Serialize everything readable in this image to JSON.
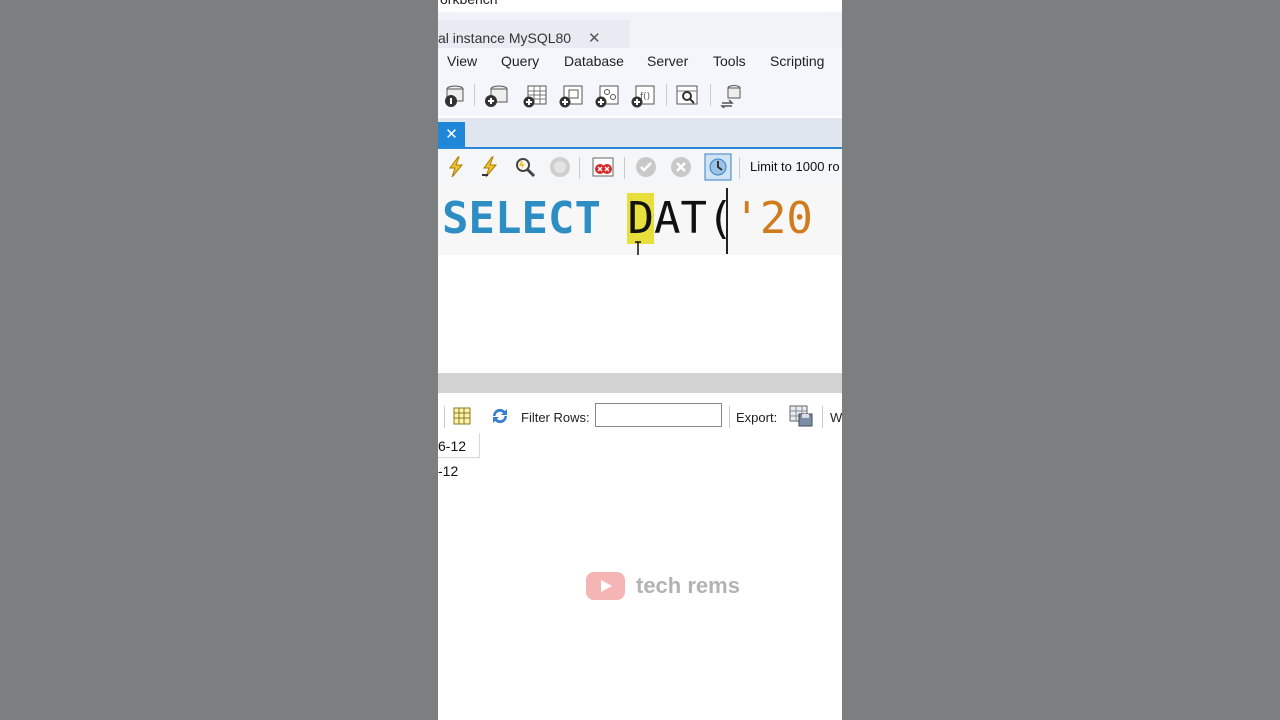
{
  "window": {
    "title_fragment": "orkbench"
  },
  "connection_tab": {
    "label": "al instance MySQL80",
    "close_label": "✕"
  },
  "menu": [
    "View",
    "Query",
    "Database",
    "Server",
    "Tools",
    "Scripting"
  ],
  "main_toolbar_icons": [
    "info-db-icon",
    "create-schema-icon",
    "create-table-icon",
    "create-view-icon",
    "create-procedure-icon",
    "create-function-icon",
    "search-table-data-icon",
    "reconnect-icon"
  ],
  "sql_tab": {
    "close_label": "✕"
  },
  "editor_toolbar": {
    "icons": [
      "execute-icon",
      "execute-current-icon",
      "explain-icon",
      "stop-icon",
      "stop-on-error-icon",
      "commit-icon",
      "rollback-icon",
      "autocommit-icon"
    ],
    "limit_label": "Limit to 1000 ro"
  },
  "editor": {
    "keyword": "SELECT",
    "highlight_char": "D",
    "typed": "AT",
    "paren": "(",
    "string_fragment": "'20"
  },
  "result_toolbar": {
    "filter_label": "Filter Rows:",
    "filter_value": "",
    "export_label": "Export:",
    "wrap_fragment": "W"
  },
  "result_rows": [
    "6-12",
    "-12"
  ],
  "watermark": {
    "text": "tech rems"
  },
  "colors": {
    "keyword": "#2c8ec3",
    "string": "#d07c1d",
    "highlight": "#e8df3c",
    "accent": "#1f86d8",
    "backdrop": "#7b7f80"
  }
}
